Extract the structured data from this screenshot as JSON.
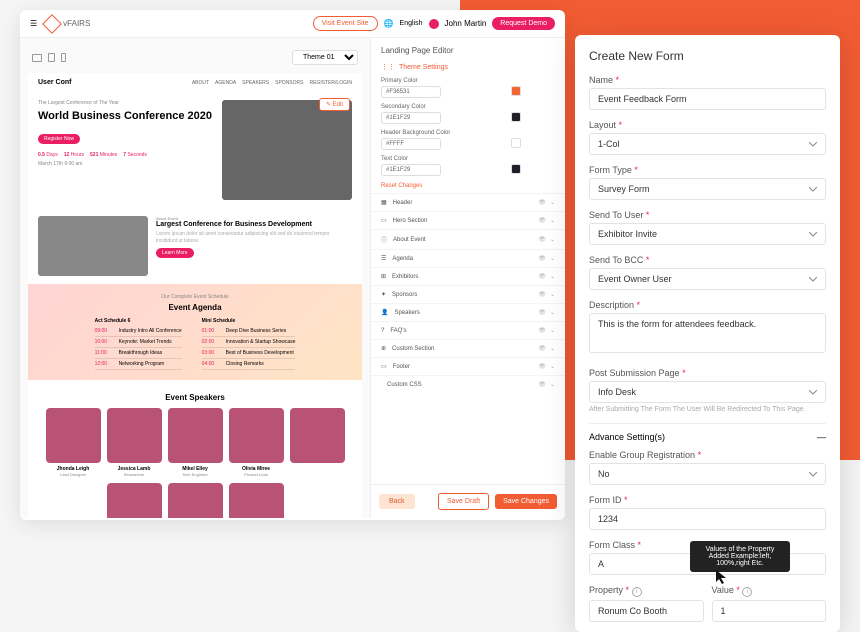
{
  "topbar": {
    "brand": "vFAIRS",
    "visit": "Visit Event Site",
    "language": "English",
    "user": "John Martin",
    "demo": "Request Demo"
  },
  "device": {
    "theme": "Theme 01"
  },
  "page": {
    "site_title": "User Conf",
    "nav": [
      "ABOUT",
      "AGENDA",
      "SPEAKERS",
      "SPONSORS",
      "REGISTER/LOGIN"
    ],
    "hero": {
      "tag": "The Largest Conference of The Year",
      "title": "World Business Conference 2020",
      "stats": [
        {
          "n": "0.5",
          "u": "Days"
        },
        {
          "n": "12",
          "u": "Hours"
        },
        {
          "n": "521",
          "u": "Minutes"
        },
        {
          "n": "7",
          "u": "Seconds"
        }
      ],
      "date": "March 17th 9:00 am",
      "edit": "Edit"
    },
    "about": {
      "tag": "About Event",
      "title": "Largest Conference for Business Development",
      "btn": "Learn More"
    },
    "agenda": {
      "tag": "Our Complete Event Schedule",
      "title": "Event Agenda",
      "col1_head": "Act Schedule 6",
      "col2_head": "Mini Schedule",
      "col1": [
        {
          "t": "09:00",
          "d": "Industry Intro All Conference"
        },
        {
          "t": "10:00",
          "d": "Keynote: Market Trends"
        },
        {
          "t": "11:00",
          "d": "Breakthrough Ideas"
        },
        {
          "t": "12:00",
          "d": "Networking Program"
        }
      ],
      "col2": [
        {
          "t": "01:00",
          "d": "Deep Dive Business Series"
        },
        {
          "t": "02:00",
          "d": "Innovation & Startup Showcase"
        },
        {
          "t": "03:00",
          "d": "Best of Business Development"
        },
        {
          "t": "04:00",
          "d": "Closing Remarks"
        }
      ]
    },
    "speakers": {
      "title": "Event Speakers",
      "list": [
        {
          "name": "Jhonda Leigh",
          "role": "Lead Designer"
        },
        {
          "name": "Jessica Lamb",
          "role": "Researcher"
        },
        {
          "name": "Mikel Elley",
          "role": "Tech Engineer"
        },
        {
          "name": "Olivia Miree",
          "role": "Product Lead"
        }
      ]
    }
  },
  "sidebar": {
    "title": "Landing Page Editor",
    "theme_settings": "Theme Settings",
    "colors": [
      {
        "label": "Primary Color",
        "value": "#F36531",
        "hex": "#F36531"
      },
      {
        "label": "Secondary Color",
        "value": "#1E1F29",
        "hex": "#1E1F29"
      },
      {
        "label": "Header Background Color",
        "value": "#FFFF",
        "hex": "#FFFFFF"
      },
      {
        "label": "Text Color",
        "value": "#1E1F29",
        "hex": "#1E1F29"
      }
    ],
    "reset": "Reset Changes",
    "sections": [
      "Header",
      "Hero Section",
      "About Event",
      "Agenda",
      "Exhibitors",
      "Sponsors",
      "Speakers",
      "FAQ's",
      "Custom Section",
      "Footer",
      "Custom CSS"
    ],
    "back": "Back",
    "draft": "Save Draft",
    "save": "Save Changes"
  },
  "form": {
    "title": "Create New Form",
    "name": {
      "label": "Name",
      "value": "Event Feedback Form"
    },
    "layout": {
      "label": "Layout",
      "value": "1-Col"
    },
    "type": {
      "label": "Form Type",
      "value": "Survey Form"
    },
    "send_user": {
      "label": "Send To User",
      "value": "Exhibitor Invite"
    },
    "send_bcc": {
      "label": "Send To BCC",
      "value": "Event Owner User"
    },
    "desc": {
      "label": "Description",
      "value": "This is the form for attendees feedback."
    },
    "post": {
      "label": "Post Submission Page",
      "value": "Info Desk",
      "helper": "After Submitting The Form The User Will Be Redirected To This Page."
    },
    "advance": "Advance Setting(s)",
    "group": {
      "label": "Enable Group Registration",
      "value": "No"
    },
    "form_id": {
      "label": "Form ID",
      "value": "1234"
    },
    "form_class": {
      "label": "Form Class",
      "value": "A"
    },
    "property": {
      "label": "Property",
      "value": "Ronum Co Booth"
    },
    "value": {
      "label": "Value",
      "value": "1"
    },
    "tooltip": "Values of the Property Added Example:left, 100%,right Etc."
  }
}
